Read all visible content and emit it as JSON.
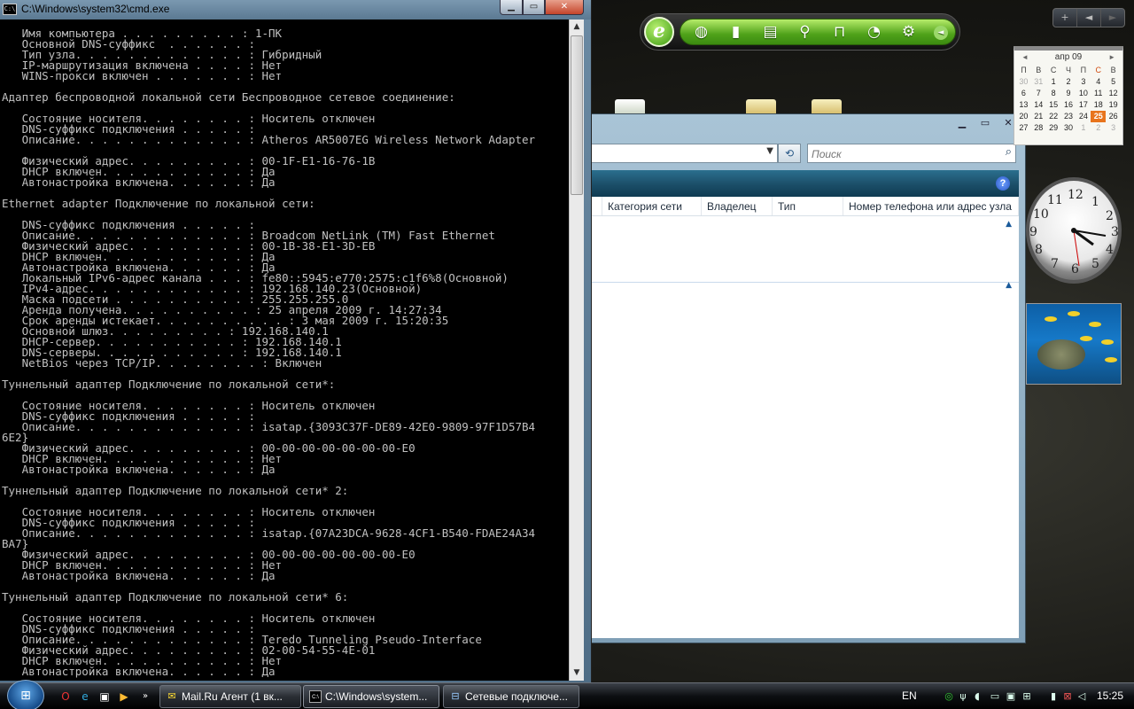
{
  "cmd_window": {
    "title": "C:\\Windows\\system32\\cmd.exe",
    "console_text": "   Имя компьютера . . . . . . . . . : 1-ПК\n   Основной DNS-суффикс  . . . . . . :\n   Тип узла. . . . . . . . . . . . . : Гибридный\n   IP-маршрутизация включена . . . . : Нет\n   WINS-прокси включен . . . . . . . : Нет\n\nАдаптер беспроводной локальной сети Беспроводное сетевое соединение:\n\n   Состояние носителя. . . . . . . . : Носитель отключен\n   DNS-суффикс подключения . . . . . :\n   Описание. . . . . . . . . . . . . : Atheros AR5007EG Wireless Network Adapter\n\n   Физический адрес. . . . . . . . . : 00-1F-E1-16-76-1B\n   DHCP включен. . . . . . . . . . . : Да\n   Автонастройка включена. . . . . . : Да\n\nEthernet adapter Подключение по локальной сети:\n\n   DNS-суффикс подключения . . . . . :\n   Описание. . . . . . . . . . . . . : Broadcom NetLink (TM) Fast Ethernet\n   Физический адрес. . . . . . . . . : 00-1B-38-E1-3D-EB\n   DHCP включен. . . . . . . . . . . : Да\n   Автонастройка включена. . . . . . : Да\n   Локальный IPv6-адрес канала . . . : fe80::5945:e770:2575:c1f6%8(Основной)\n   IPv4-адрес. . . . . . . . . . . . : 192.168.140.23(Основной)\n   Маска подсети . . . . . . . . . . : 255.255.255.0\n   Аренда получена. . . . . . . . . . : 25 апреля 2009 г. 14:27:34\n   Срок аренды истекает. . . . . . . . . . : 3 мая 2009 г. 15:20:35\n   Основной шлюз. . . . . . . . . : 192.168.140.1\n   DHCP-сервер. . . . . . . . . . . : 192.168.140.1\n   DNS-серверы. . . . . . . . . . . : 192.168.140.1\n   NetBios через TCP/IP. . . . . . . . : Включен\n\nТуннельный адаптер Подключение по локальной сети*:\n\n   Состояние носителя. . . . . . . . : Носитель отключен\n   DNS-суффикс подключения . . . . . :\n   Описание. . . . . . . . . . . . . : isatap.{3093C37F-DE89-42E0-9809-97F1D57B4\n6E2}\n   Физический адрес. . . . . . . . . : 00-00-00-00-00-00-00-E0\n   DHCP включен. . . . . . . . . . . : Нет\n   Автонастройка включена. . . . . . : Да\n\nТуннельный адаптер Подключение по локальной сети* 2:\n\n   Состояние носителя. . . . . . . . : Носитель отключен\n   DNS-суффикс подключения . . . . . :\n   Описание. . . . . . . . . . . . . : isatap.{07A23DCA-9628-4CF1-B540-FDAE24A34\nBA7}\n   Физический адрес. . . . . . . . . : 00-00-00-00-00-00-00-E0\n   DHCP включен. . . . . . . . . . . : Нет\n   Автонастройка включена. . . . . . : Да\n\nТуннельный адаптер Подключение по локальной сети* 6:\n\n   Состояние носителя. . . . . . . . : Носитель отключен\n   DNS-суффикс подключения . . . . . :\n   Описание. . . . . . . . . . . . . : Teredo Tunneling Pseudo-Interface\n   Физический адрес. . . . . . . . . : 02-00-54-55-4E-01\n   DHCP включен. . . . . . . . . . . : Нет\n   Автонастройка включена. . . . . . : Да"
  },
  "network_window": {
    "search_placeholder": "Поиск",
    "help_label": "?",
    "columns": [
      "Категория сети",
      "Владелец",
      "Тип",
      "Номер телефона или адрес узла"
    ]
  },
  "calendar": {
    "month_label": "апр 09",
    "weekdays": [
      "П",
      "В",
      "С",
      "Ч",
      "П",
      "С",
      "В"
    ],
    "weeks": [
      [
        "30",
        "31",
        "1",
        "2",
        "3",
        "4",
        "5"
      ],
      [
        "6",
        "7",
        "8",
        "9",
        "10",
        "11",
        "12"
      ],
      [
        "13",
        "14",
        "15",
        "16",
        "17",
        "18",
        "19"
      ],
      [
        "20",
        "21",
        "22",
        "23",
        "24",
        "25",
        "26"
      ],
      [
        "27",
        "28",
        "29",
        "30",
        "1",
        "2",
        "3"
      ]
    ],
    "today": "25"
  },
  "clock": {
    "numbers": [
      "12",
      "1",
      "2",
      "3",
      "4",
      "5",
      "6",
      "7",
      "8",
      "9",
      "10",
      "11"
    ]
  },
  "sidebar_controls": {
    "add": "+",
    "prev": "◄",
    "next": "►"
  },
  "taskbar": {
    "buttons": [
      {
        "label": "Mail.Ru Агент (1 вк...",
        "icon": "envelope-icon"
      },
      {
        "label": "C:\\Windows\\system...",
        "icon": "cmd-icon"
      },
      {
        "label": "Сетевые подключе...",
        "icon": "network-icon"
      }
    ],
    "language": "EN",
    "time": "15:25"
  },
  "colors": {
    "console_bg": "#000000",
    "console_text": "#c0c0c0",
    "accent_green": "#4fa21a",
    "calendar_today": "#e8741c"
  }
}
